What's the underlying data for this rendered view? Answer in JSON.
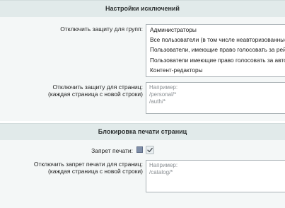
{
  "exceptions_section": {
    "title": "Настройки исключений",
    "groups_label": "Отключить защиту для групп:",
    "groups_options": [
      "Администраторы",
      "Все пользователи (в том числе неавторизованные)",
      "Пользователи, имеющие право голосовать за рейтинг",
      "Пользователи имеющие право голосовать за авторитет",
      "Контент-редакторы"
    ],
    "pages_label_line1": "Отключить защиту для страниц:",
    "pages_label_line2": "(каждая страница с новой строки)",
    "pages_placeholder": "Например:\n/personal/*\n/auth/*"
  },
  "print_section": {
    "title": "Блокировка печати страниц",
    "print_ban_label": "Запрет печати:",
    "print_ban_checked": true,
    "pages_label_line1": "Отключить запрет печати для страниц:",
    "pages_label_line2": "(каждая страница с новой строки)",
    "pages_placeholder": "Например:\n/catalog/*"
  },
  "colors": {
    "header_bg": "#e1eaea",
    "body_bg": "#f4f7f7",
    "field_border": "#a8b0b4",
    "placeholder_text": "#8a8f93"
  },
  "icons": {
    "print_ban_help": "help-icon",
    "checkbox_mark": "checkmark-icon"
  }
}
